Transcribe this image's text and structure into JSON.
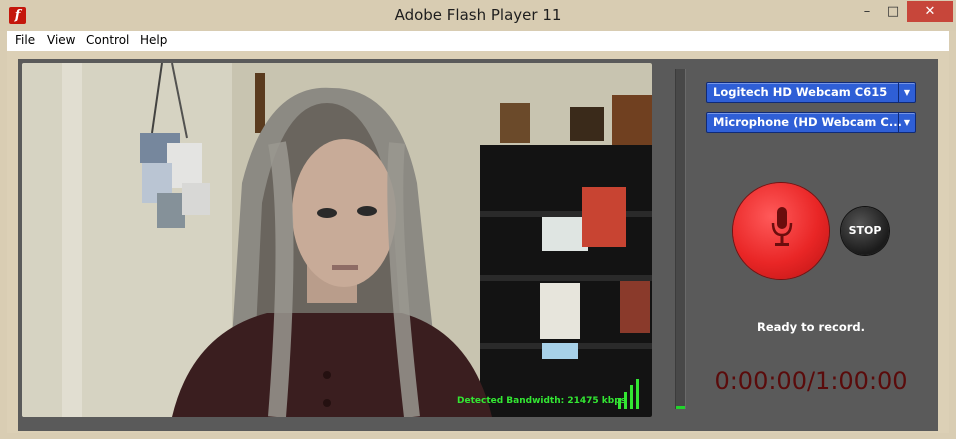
{
  "window": {
    "title": "Adobe Flash Player 11",
    "icon": "flash-icon",
    "app_icon_glyph": "f",
    "controls": {
      "minimize": "–",
      "maximize": "□",
      "close": "✕"
    }
  },
  "menu": {
    "items": [
      "File",
      "View",
      "Control",
      "Help"
    ]
  },
  "video": {
    "bandwidth_text": "Detected Bandwidth: 21475 kbps",
    "signal_icon": "signal-bars-icon",
    "signal_levels": [
      0.35,
      0.55,
      0.8,
      1.0
    ]
  },
  "audio_level": {
    "value": 0.01
  },
  "devices": {
    "camera": "Logitech HD Webcam C615",
    "microphone": "Microphone (HD Webcam C..."
  },
  "controls": {
    "record_icon": "microphone-icon",
    "stop_label": "STOP"
  },
  "status": {
    "text": "Ready to record.",
    "timer": "0:00:00/1:00:00"
  },
  "colors": {
    "accent_select": "#2f5fd6",
    "record_red": "#e92626",
    "timer_text": "#5a0b0b",
    "bandwidth_green": "#33e633",
    "close_button": "#c7463a"
  }
}
